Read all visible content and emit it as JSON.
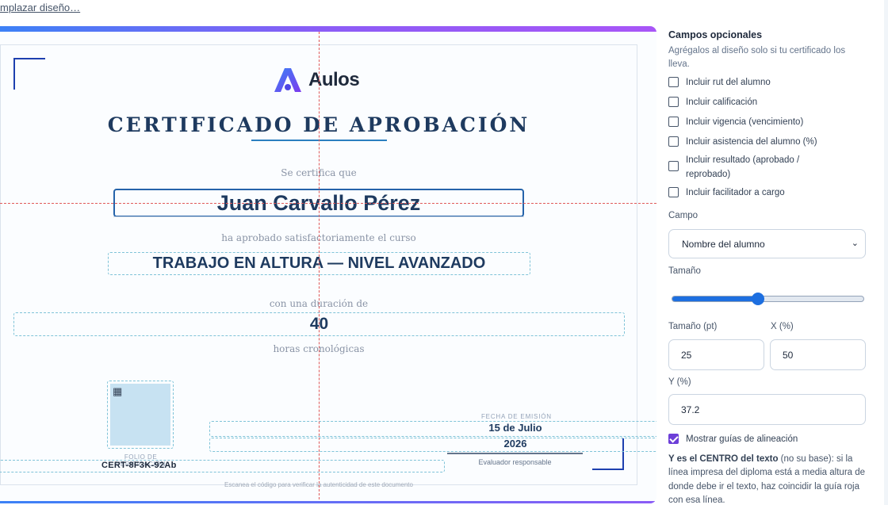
{
  "top_link": "mplazar diseño…",
  "certificate": {
    "logo_text": "Aulos",
    "title": "CERTIFICADO DE APROBACIÓN",
    "se_certifica": "Se certifica que",
    "student_name": "Juan Carvallo Pérez",
    "ha_aprobado": "ha aprobado satisfactoriamente el curso",
    "course_name": "TRABAJO EN ALTURA — NIVEL AVANZADO",
    "con_duracion": "con una duración de",
    "hours": "40",
    "horas_label": "horas cronológicas",
    "folio_label": "FOLIO DE VERIFICACIÓN",
    "folio_value": "CERT-8F3K-92Ab",
    "fecha_label": "FECHA DE EMISIÓN",
    "fecha_line1": "15 de Julio",
    "fecha_line2": "2026",
    "evaluador": "Evaluador responsable",
    "escanea": "Escanea el código para verificar la autenticidad de este documento",
    "accent_color": "#2b7fc0",
    "guide_color": "#e05a5a"
  },
  "panel": {
    "title": "Campos opcionales",
    "description": "Agrégalos al diseño solo si tu certificado los lleva.",
    "checkboxes": [
      {
        "label": "Incluir rut del alumno",
        "checked": false
      },
      {
        "label": "Incluir calificación",
        "checked": false
      },
      {
        "label": "Incluir vigencia (vencimiento)",
        "checked": false
      },
      {
        "label": "Incluir asistencia del alumno (%)",
        "checked": false
      },
      {
        "label": "Incluir resultado (aprobado / reprobado)",
        "checked": false
      },
      {
        "label": "Incluir facilitador a cargo",
        "checked": false
      }
    ],
    "campo_label": "Campo",
    "campo_value": "Nombre del alumno",
    "tamano_label": "Tamaño",
    "slider_fraction": 0.45,
    "tamano_pt_label": "Tamaño (pt)",
    "tamano_pt_value": "25",
    "x_label": "X (%)",
    "x_value": "50",
    "y_label": "Y (%)",
    "y_value": "37.2",
    "guides_label": "Mostrar guías de alineación",
    "guides_checked": true,
    "help_bold": "Y es el CENTRO del texto",
    "help_text": " (no su base): si la línea impresa del diploma está a media altura de donde debe ir el texto, haz coincidir la guía roja con esa línea.",
    "accent_color": "#6d3fd8"
  }
}
